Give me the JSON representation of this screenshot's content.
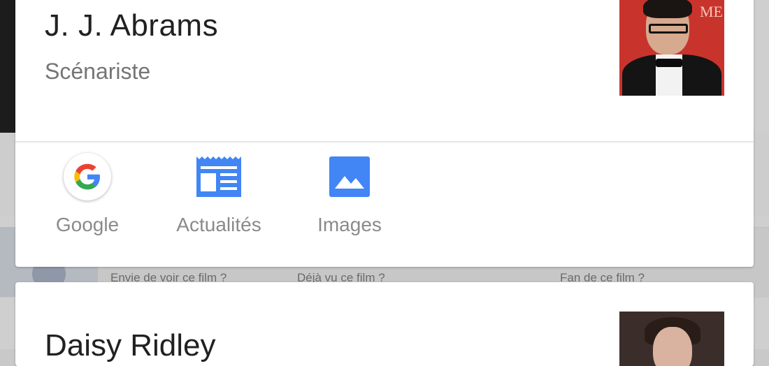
{
  "background": {
    "labels": [
      "Envie de voir ce film ?",
      "Déjà vu ce film ?",
      "Fan de ce film ?"
    ]
  },
  "card1": {
    "name": "J. J. Abrams",
    "subtitle": "Scénariste",
    "photo_caption": "ME",
    "actions": [
      {
        "label": "Google",
        "icon": "google-icon"
      },
      {
        "label": "Actualités",
        "icon": "news-icon"
      },
      {
        "label": "Images",
        "icon": "image-icon"
      }
    ]
  },
  "card2": {
    "name": "Daisy Ridley"
  },
  "colors": {
    "accent_blue": "#4285f4",
    "google_red": "#ea4335",
    "google_yellow": "#fbbc05",
    "google_green": "#34a853"
  }
}
